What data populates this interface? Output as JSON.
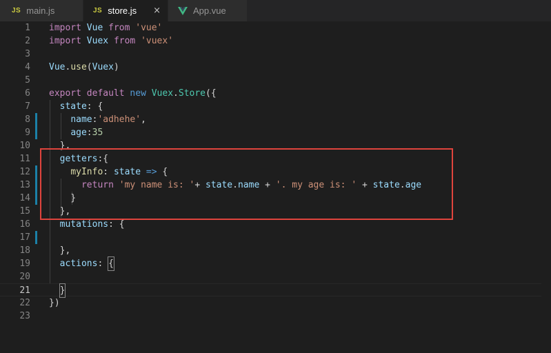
{
  "tabs": [
    {
      "label": "main.js",
      "icon": "JS",
      "active": false
    },
    {
      "label": "store.js",
      "icon": "JS",
      "active": true
    },
    {
      "label": "App.vue",
      "icon": "vue-icon",
      "active": false
    }
  ],
  "close_glyph": "×",
  "colors": {
    "keyword": "#c586c0",
    "keyword_blue": "#569cd6",
    "string": "#ce9178",
    "number": "#b5cea8",
    "property": "#9cdcfe",
    "class": "#4ec9b0",
    "annotation_box": "#e0443d",
    "vue_green": "#41b883"
  },
  "current_line": 21,
  "lines": [
    {
      "n": "1",
      "tokens": [
        [
          "kw",
          "import"
        ],
        [
          "plain",
          " "
        ],
        [
          "prop",
          "Vue"
        ],
        [
          "plain",
          " "
        ],
        [
          "kw",
          "from"
        ],
        [
          "plain",
          " "
        ],
        [
          "str",
          "'vue'"
        ]
      ]
    },
    {
      "n": "2",
      "tokens": [
        [
          "kw",
          "import"
        ],
        [
          "plain",
          " "
        ],
        [
          "prop",
          "Vuex"
        ],
        [
          "plain",
          " "
        ],
        [
          "kw",
          "from"
        ],
        [
          "plain",
          " "
        ],
        [
          "str",
          "'vuex'"
        ]
      ]
    },
    {
      "n": "3",
      "tokens": []
    },
    {
      "n": "4",
      "tokens": [
        [
          "prop",
          "Vue"
        ],
        [
          "plain",
          "."
        ],
        [
          "fn",
          "use"
        ],
        [
          "plain",
          "("
        ],
        [
          "prop",
          "Vuex"
        ],
        [
          "plain",
          ")"
        ]
      ]
    },
    {
      "n": "5",
      "tokens": []
    },
    {
      "n": "6",
      "tokens": [
        [
          "kw",
          "export"
        ],
        [
          "plain",
          " "
        ],
        [
          "kw",
          "default"
        ],
        [
          "plain",
          " "
        ],
        [
          "kw2",
          "new"
        ],
        [
          "plain",
          " "
        ],
        [
          "cls",
          "Vuex"
        ],
        [
          "plain",
          "."
        ],
        [
          "cls",
          "Store"
        ],
        [
          "plain",
          "({"
        ]
      ]
    },
    {
      "n": "7",
      "tokens": [
        [
          "plain",
          "  "
        ],
        [
          "prop",
          "state"
        ],
        [
          "plain",
          ": {"
        ]
      ]
    },
    {
      "n": "8",
      "tokens": [
        [
          "plain",
          "    "
        ],
        [
          "prop",
          "name"
        ],
        [
          "plain",
          ":"
        ],
        [
          "str",
          "'adhehe'"
        ],
        [
          "plain",
          ","
        ]
      ]
    },
    {
      "n": "9",
      "tokens": [
        [
          "plain",
          "    "
        ],
        [
          "prop",
          "age"
        ],
        [
          "plain",
          ":"
        ],
        [
          "num",
          "35"
        ]
      ]
    },
    {
      "n": "10",
      "tokens": [
        [
          "plain",
          "  },"
        ]
      ]
    },
    {
      "n": "11",
      "tokens": [
        [
          "plain",
          "  "
        ],
        [
          "prop",
          "getters"
        ],
        [
          "plain",
          ":{"
        ]
      ]
    },
    {
      "n": "12",
      "tokens": [
        [
          "plain",
          "    "
        ],
        [
          "fn",
          "myInfo"
        ],
        [
          "plain",
          ": "
        ],
        [
          "prop",
          "state"
        ],
        [
          "plain",
          " "
        ],
        [
          "kw2",
          "=>"
        ],
        [
          "plain",
          " {"
        ]
      ]
    },
    {
      "n": "13",
      "tokens": [
        [
          "plain",
          "      "
        ],
        [
          "kw",
          "return"
        ],
        [
          "plain",
          " "
        ],
        [
          "str",
          "'my name is: '"
        ],
        [
          "plain",
          "+ "
        ],
        [
          "prop",
          "state"
        ],
        [
          "plain",
          "."
        ],
        [
          "prop",
          "name"
        ],
        [
          "plain",
          " + "
        ],
        [
          "str",
          "'. my age is: '"
        ],
        [
          "plain",
          " + "
        ],
        [
          "prop",
          "state"
        ],
        [
          "plain",
          "."
        ],
        [
          "prop",
          "age"
        ]
      ]
    },
    {
      "n": "14",
      "tokens": [
        [
          "plain",
          "    }"
        ]
      ]
    },
    {
      "n": "15",
      "tokens": [
        [
          "plain",
          "  },"
        ]
      ]
    },
    {
      "n": "16",
      "tokens": [
        [
          "plain",
          "  "
        ],
        [
          "prop",
          "mutations"
        ],
        [
          "plain",
          ": {"
        ]
      ]
    },
    {
      "n": "17",
      "tokens": []
    },
    {
      "n": "18",
      "tokens": [
        [
          "plain",
          "  },"
        ]
      ]
    },
    {
      "n": "19",
      "tokens": [
        [
          "plain",
          "  "
        ],
        [
          "prop",
          "actions"
        ],
        [
          "plain",
          ": "
        ],
        [
          "box",
          "{"
        ]
      ]
    },
    {
      "n": "20",
      "tokens": []
    },
    {
      "n": "21",
      "tokens": [
        [
          "plain",
          "  "
        ],
        [
          "box",
          "}"
        ]
      ]
    },
    {
      "n": "22",
      "tokens": [
        [
          "plain",
          "})"
        ]
      ]
    },
    {
      "n": "23",
      "tokens": []
    }
  ]
}
